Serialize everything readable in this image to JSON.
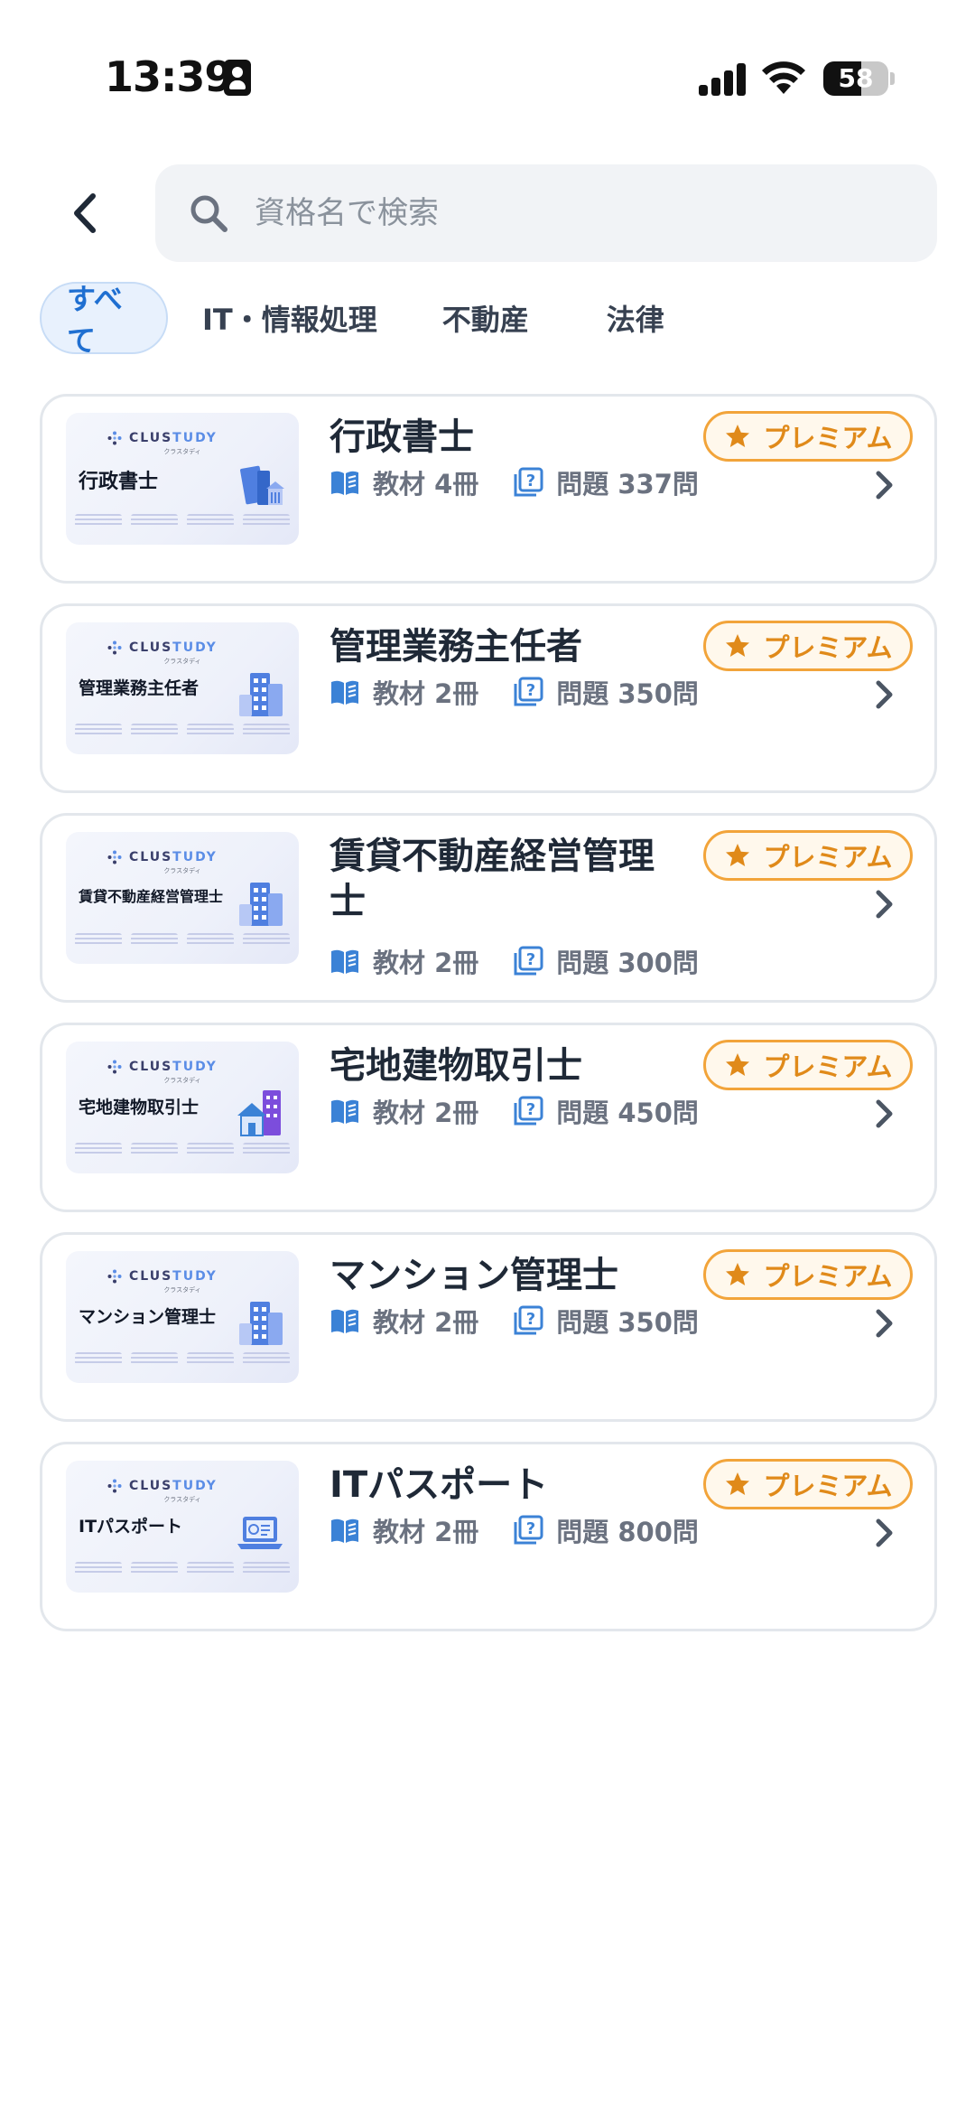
{
  "status_bar": {
    "time": "13:39",
    "battery_percent": "58",
    "battery_level": 0.58
  },
  "header": {
    "search_placeholder": "資格名で検索"
  },
  "tabs": [
    {
      "label": "すべて",
      "active": true
    },
    {
      "label": "IT・情報処理",
      "active": false
    },
    {
      "label": "不動産",
      "active": false
    },
    {
      "label": "法律",
      "active": false
    }
  ],
  "thumb_brand": {
    "brand_a": "CLUS",
    "brand_b": "TUDY",
    "tagline": "クラスタディ"
  },
  "colors": {
    "accent": "#1f6fd1",
    "premium": "#e08a1a",
    "icon_blue": "#3b82d6"
  },
  "items": [
    {
      "title": "行政書士",
      "thumb_title": "行政書士",
      "thumb_icon": "law-books-icon",
      "materials": "教材 4冊",
      "questions": "問題 337問",
      "badge": "プレミアム"
    },
    {
      "title": "管理業務主任者",
      "thumb_title": "管理業務主任者",
      "thumb_icon": "building-icon",
      "materials": "教材 2冊",
      "questions": "問題 350問",
      "badge": "プレミアム"
    },
    {
      "title": "賃貸不動産経営管理士",
      "thumb_title": "賃貸不動産経営管理士",
      "thumb_icon": "building-icon",
      "materials": "教材 2冊",
      "questions": "問題 300問",
      "badge": "プレミアム"
    },
    {
      "title": "宅地建物取引士",
      "thumb_title": "宅地建物取引士",
      "thumb_icon": "house-icon",
      "materials": "教材 2冊",
      "questions": "問題 450問",
      "badge": "プレミアム"
    },
    {
      "title": "マンション管理士",
      "thumb_title": "マンション管理士",
      "thumb_icon": "building-icon",
      "materials": "教材 2冊",
      "questions": "問題 350問",
      "badge": "プレミアム"
    },
    {
      "title": "ITパスポート",
      "thumb_title": "ITパスポート",
      "thumb_icon": "laptop-icon",
      "materials": "教材 2冊",
      "questions": "問題 800問",
      "badge": "プレミアム"
    }
  ]
}
